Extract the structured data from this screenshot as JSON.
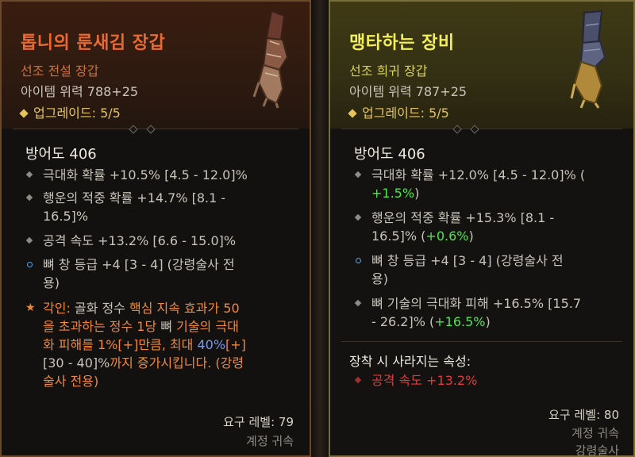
{
  "left": {
    "name": "톱니의 룬새김 장갑",
    "type": "선조 전설 장갑",
    "item_power": "아이템 위력 788+25",
    "upgrade": "업그레이드: 5/5",
    "armor": "방어도 406",
    "affixes": [
      {
        "lines": [
          "극대화 확률 +10.5% [4.5 - 12.0]%"
        ]
      },
      {
        "lines": [
          "행운의 적중 확률 +14.7% [8.1 -",
          "16.5]%"
        ]
      },
      {
        "lines": [
          "공격 속도 +13.2% [6.6 - 15.0]%"
        ]
      },
      {
        "lines": [
          "뼈 창 등급 +4 [3 - 4] (강령술사 전",
          "용)"
        ]
      }
    ],
    "aspect": {
      "l1a": "각인: ",
      "l1b": "골화 정수",
      "l1c": " 핵심 지속 효과가 50",
      "l2a": "을 초과하는 정수 1당 ",
      "l2b": "뼈",
      "l2c": " 기술의 극대",
      "l3a": "화 피해를 1%[+]만큼, 최대 ",
      "l3b": "40%",
      "l3c": "[+]",
      "l4a": "[30 - 40]%",
      "l4b": "까지 증가시킵니다. (강령",
      "l5": "술사 전용)"
    },
    "required_level": "요구 레벨: 79",
    "account_bound": "계정 귀속"
  },
  "right": {
    "name": "맹타하는 장비",
    "type": "선조 희귀 장갑",
    "item_power": "아이템 위력 787+25",
    "upgrade": "업그레이드: 5/5",
    "armor": "방어도 406",
    "a1": {
      "l1": "극대화 확률 +12.0% [4.5 - 12.0]% (",
      "l2": "+1.5%",
      "l2b": ")"
    },
    "a2": {
      "l1": "행운의 적중 확률 +15.3% [8.1 -",
      "l2a": "16.5]% (",
      "l2b": "+0.6%",
      "l2c": ")"
    },
    "a3": {
      "l1": "뼈 창 등급 +4 [3 - 4] (강령술사 전",
      "l2": "용)"
    },
    "a4": {
      "l1": "뼈 기술의 극대화 피해 +16.5% [15.7",
      "l2a": "- 26.2]% (",
      "l2b": "+16.5%",
      "l2c": ")"
    },
    "lost_title": "장착 시 사라지는 속성:",
    "lost_affix": "공격 속도 +13.2%",
    "required_level": "요구 레벨: 80",
    "account_bound": "계정 귀속",
    "class_req": "강령술사"
  }
}
